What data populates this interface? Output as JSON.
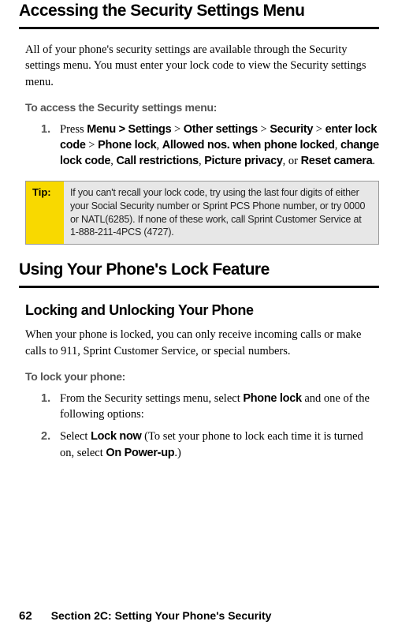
{
  "section1": {
    "heading": "Accessing the Security Settings Menu",
    "intro": "All of your phone's security settings are available through the Security settings menu. You must enter your lock code to view the Security settings menu.",
    "procHeading": "To access the Security settings menu:",
    "step1_num": "1.",
    "step1_pre": "Press ",
    "step1_menu": "Menu > Settings",
    "step1_gt1": " > ",
    "step1_other": "Other settings",
    "step1_gt2": " > ",
    "step1_security": "Security",
    "step1_gt3": " > ",
    "step1_enter": "enter lock code",
    "step1_gt4": " > ",
    "step1_phonelock": "Phone lock",
    "step1_c1": ", ",
    "step1_allowed": "Allowed nos. when phone locked",
    "step1_c2": ", ",
    "step1_change": "change lock code",
    "step1_c3": ", ",
    "step1_callr": "Call restrictions",
    "step1_c4": ", ",
    "step1_picture": "Picture privacy",
    "step1_c5": ", or ",
    "step1_reset": "Reset camera",
    "step1_end": "."
  },
  "tip": {
    "label": "Tip:",
    "text": "If you can't recall your lock code, try using the last four digits of either your Social Security number or Sprint PCS Phone number, or try 0000 or NATL(6285). If none of these work, call Sprint Customer Service at 1-888-211-4PCS (4727)."
  },
  "section2": {
    "heading": "Using Your Phone's Lock Feature",
    "sub1": "Locking and Unlocking Your Phone",
    "intro": "When your phone is locked, you can only receive incoming calls or make calls to 911, Sprint Customer Service, or special numbers.",
    "procHeading": "To lock your phone:",
    "step1_num": "1.",
    "step1_pre": "From the Security settings menu, select ",
    "step1_b1": "Phone lock",
    "step1_post": " and one of the following options:",
    "step2_num": "2.",
    "step2_pre": "Select ",
    "step2_b1": "Lock now",
    "step2_mid": " (To set your phone to lock each time it is turned on, select ",
    "step2_b2": "On Power-up",
    "step2_end": ".)"
  },
  "footer": {
    "page": "62",
    "section": "Section 2C: Setting Your Phone's Security"
  }
}
